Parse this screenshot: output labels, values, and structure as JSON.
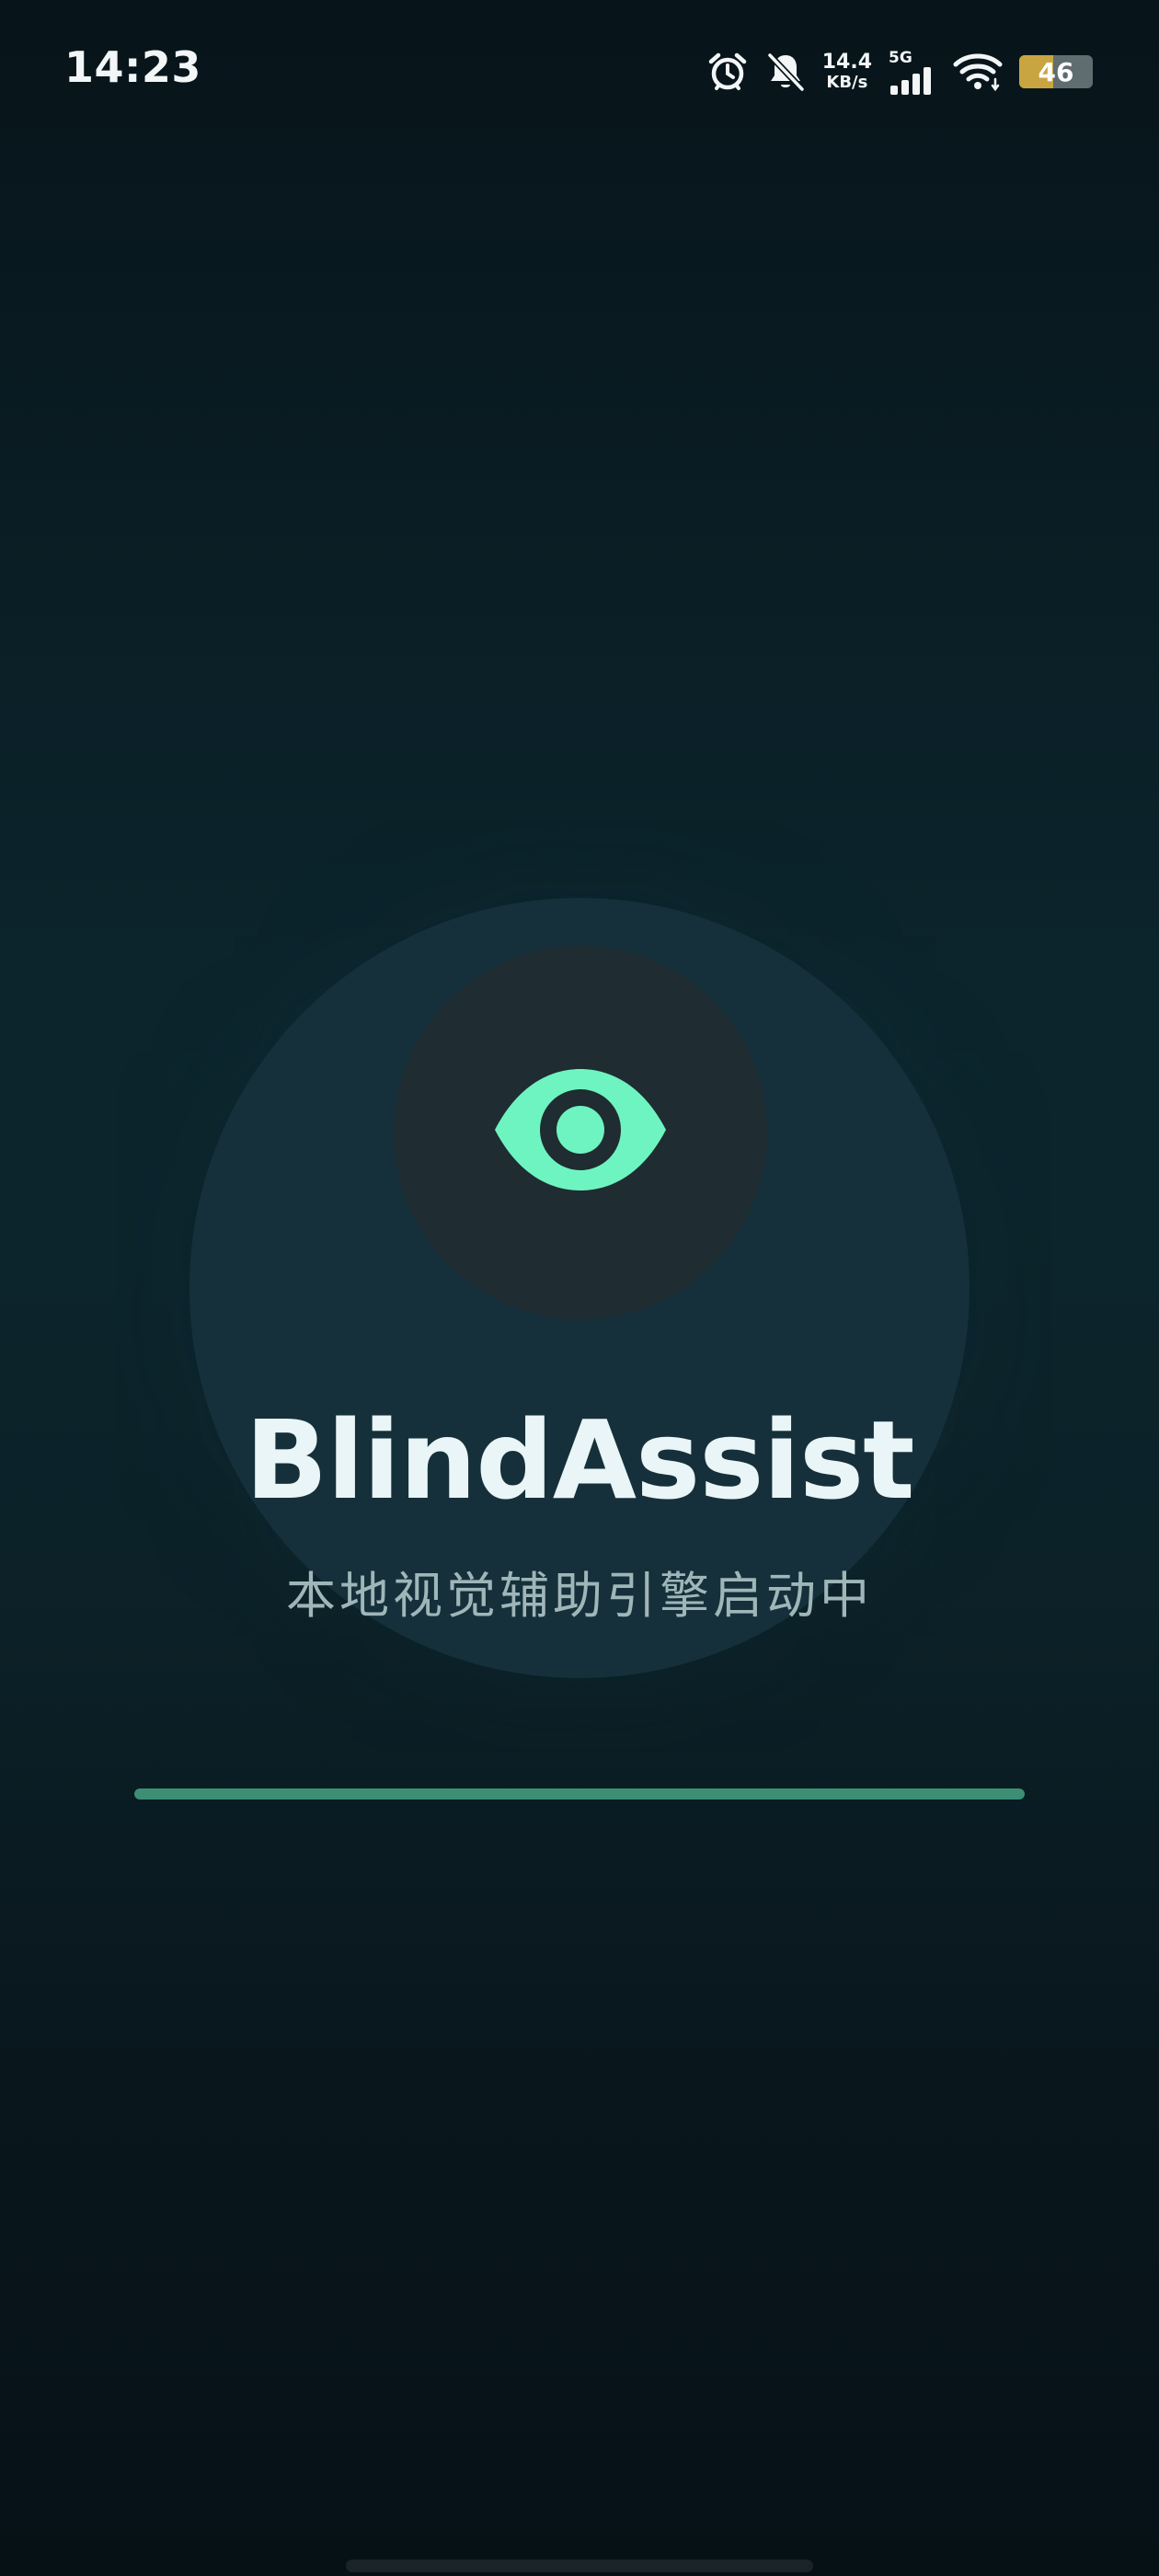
{
  "status_bar": {
    "time": "14:23",
    "net_speed_value": "14.4",
    "net_speed_unit": "KB/s",
    "network_generation": "5G",
    "battery_level": "46",
    "battery_fraction": 0.46,
    "icons": [
      "alarm-icon",
      "bell-off-icon",
      "signal-icon",
      "wifi-icon",
      "battery-icon"
    ]
  },
  "splash": {
    "logo_icon": "eye-icon",
    "title": "BlindAssist",
    "subtitle": "本地视觉辅助引擎启动中",
    "progress": 1.0
  },
  "colors": {
    "accent": "#6ef4c0",
    "title": "#e9f5f6",
    "subtitle": "#9fb6b9",
    "progress": "#3c8f74",
    "circle_outer": "#15303a",
    "circle_inner": "#1f2c31"
  }
}
